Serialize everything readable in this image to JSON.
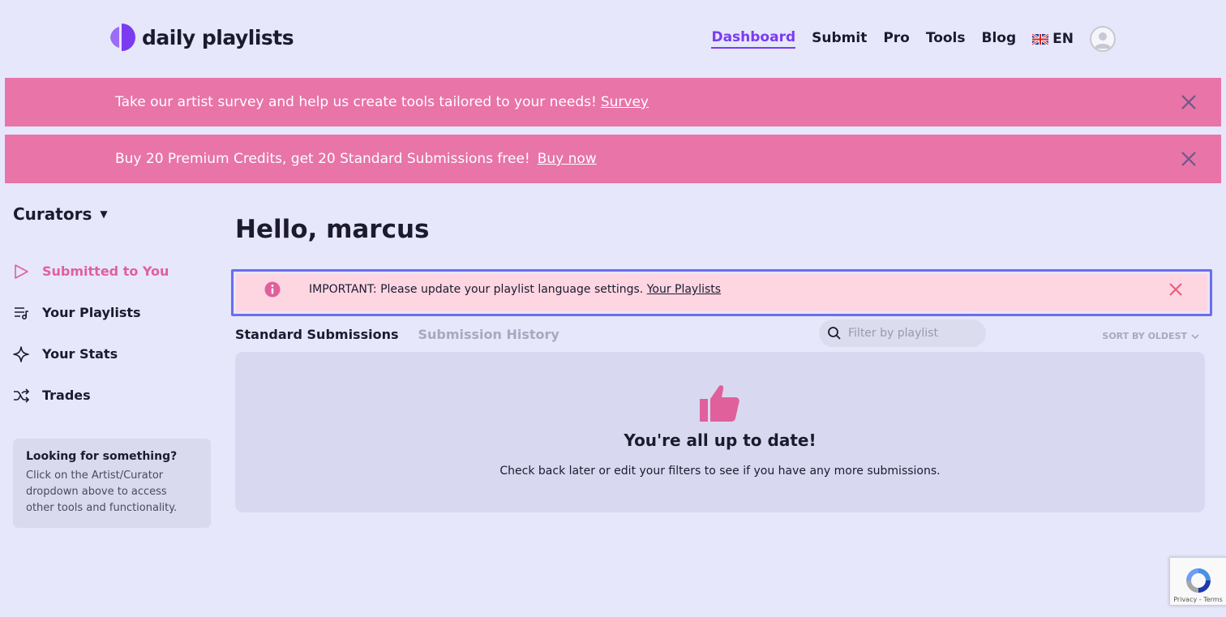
{
  "header": {
    "logo_text": "daily playlists",
    "nav": [
      {
        "label": "Dashboard",
        "active": true
      },
      {
        "label": "Submit"
      },
      {
        "label": "Pro"
      },
      {
        "label": "Tools"
      },
      {
        "label": "Blog"
      }
    ],
    "language": "EN"
  },
  "banners": [
    {
      "text": "Take our artist survey and help us create tools tailored to your needs!",
      "link": "Survey"
    },
    {
      "text": "Buy 20 Premium Credits, get 20 Standard Submissions free!",
      "link": "Buy now"
    }
  ],
  "sidebar": {
    "role_label": "Curators",
    "items": [
      {
        "label": "Submitted to You",
        "icon": "play-icon",
        "active": true
      },
      {
        "label": "Your Playlists",
        "icon": "playlist-icon"
      },
      {
        "label": "Your Stats",
        "icon": "sparkle-icon"
      },
      {
        "label": "Trades",
        "icon": "shuffle-icon"
      }
    ],
    "help": {
      "title": "Looking for something?",
      "text": "Click on the Artist/Curator dropdown above to access other tools and functionality."
    }
  },
  "main": {
    "greeting": "Hello, marcus",
    "notice": {
      "text": "IMPORTANT: Please update your playlist language settings.",
      "link": "Your Playlists"
    },
    "tabs": [
      {
        "label": "Standard Submissions",
        "active": true
      },
      {
        "label": "Submission History"
      }
    ],
    "filter_placeholder": "Filter by playlist",
    "sort_label": "SORT BY OLDEST",
    "empty": {
      "title": "You're all up to date!",
      "text": "Check back later or edit your filters to see if you have any more submissions."
    }
  },
  "recaptcha": {
    "terms": "Privacy - Terms"
  },
  "colors": {
    "accent": "#7b3cf0",
    "banner": "#e874a8",
    "pink": "#e0609c",
    "background": "#e6e7fb"
  }
}
